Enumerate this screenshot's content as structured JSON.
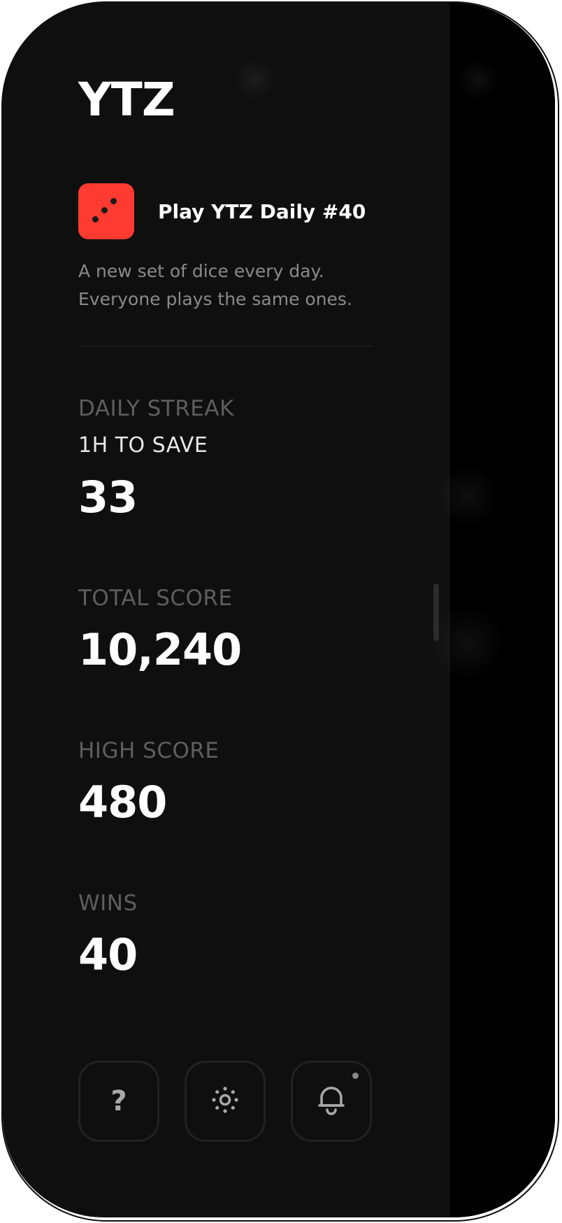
{
  "app": {
    "logo_text": "YTZ"
  },
  "daily": {
    "label": "Play YTZ Daily #40",
    "icon": "dice-three-icon",
    "icon_color": "#ff3a30",
    "tagline_line1": "A new set of dice every day.",
    "tagline_line2": "Everyone plays the same ones."
  },
  "stats": {
    "daily_streak": {
      "label": "DAILY STREAK",
      "sub": "1H TO SAVE",
      "value": "33"
    },
    "total_score": {
      "label": "TOTAL SCORE",
      "value": "10,240"
    },
    "high_score": {
      "label": "HIGH SCORE",
      "value": "480"
    },
    "wins": {
      "label": "WINS",
      "value": "40"
    }
  },
  "toolbar": {
    "help_glyph": "?",
    "help_icon": "question-icon",
    "settings_icon": "sun-icon",
    "notifications_icon": "bell-icon",
    "notification_dot": true
  },
  "colors": {
    "background": "#0f0f0f",
    "side_panel": "#000000",
    "accent": "#ff3a30",
    "muted_text": "#5e5e5e"
  }
}
